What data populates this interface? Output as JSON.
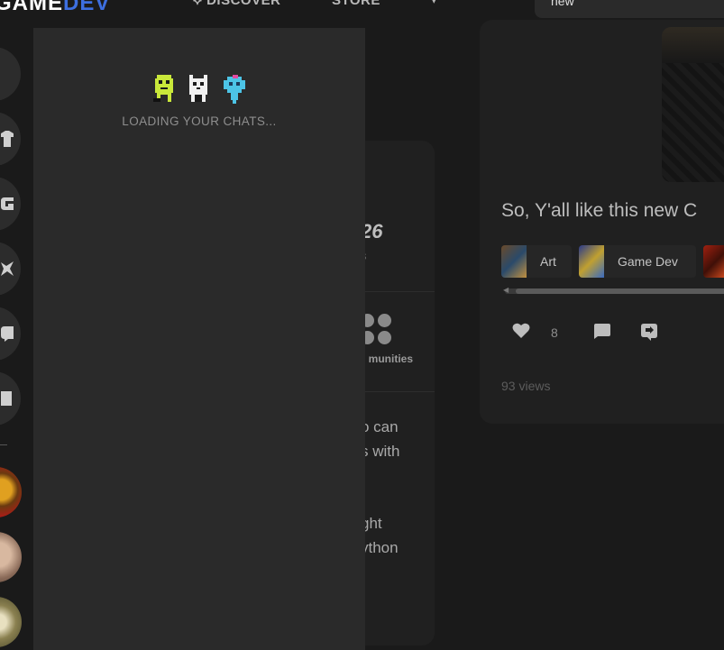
{
  "header": {
    "logo_text_a": "GAME",
    "logo_text_b": "DEV",
    "nav": {
      "discover": "⟡ DISCOVER",
      "store": "STORE",
      "more": "▾"
    },
    "search_value": "new"
  },
  "rail": {
    "buttons": [
      "home-icon",
      "shirt-icon",
      "game-icon",
      "wings-icon",
      "chat-icon",
      "book-icon"
    ]
  },
  "feed": {
    "stat_number": "26",
    "stat_caption": "s",
    "communities_label": "munities",
    "lines": [
      "o can",
      "s with",
      "ght",
      "ython"
    ]
  },
  "post": {
    "title": "So, Y'all like this new C",
    "tags": [
      {
        "label": "Art"
      },
      {
        "label": "Game Dev"
      }
    ],
    "like_count": "8",
    "views": "93 views"
  },
  "chat": {
    "loading_text": "LOADING YOUR CHATS..."
  },
  "colors": {
    "background": "#1a1a1a",
    "panel": "#2a2a2a",
    "card": "#202020",
    "brand_blue": "#3d6fe0",
    "sprite_green": "#c9e83a",
    "sprite_blue": "#4cc4e6"
  }
}
